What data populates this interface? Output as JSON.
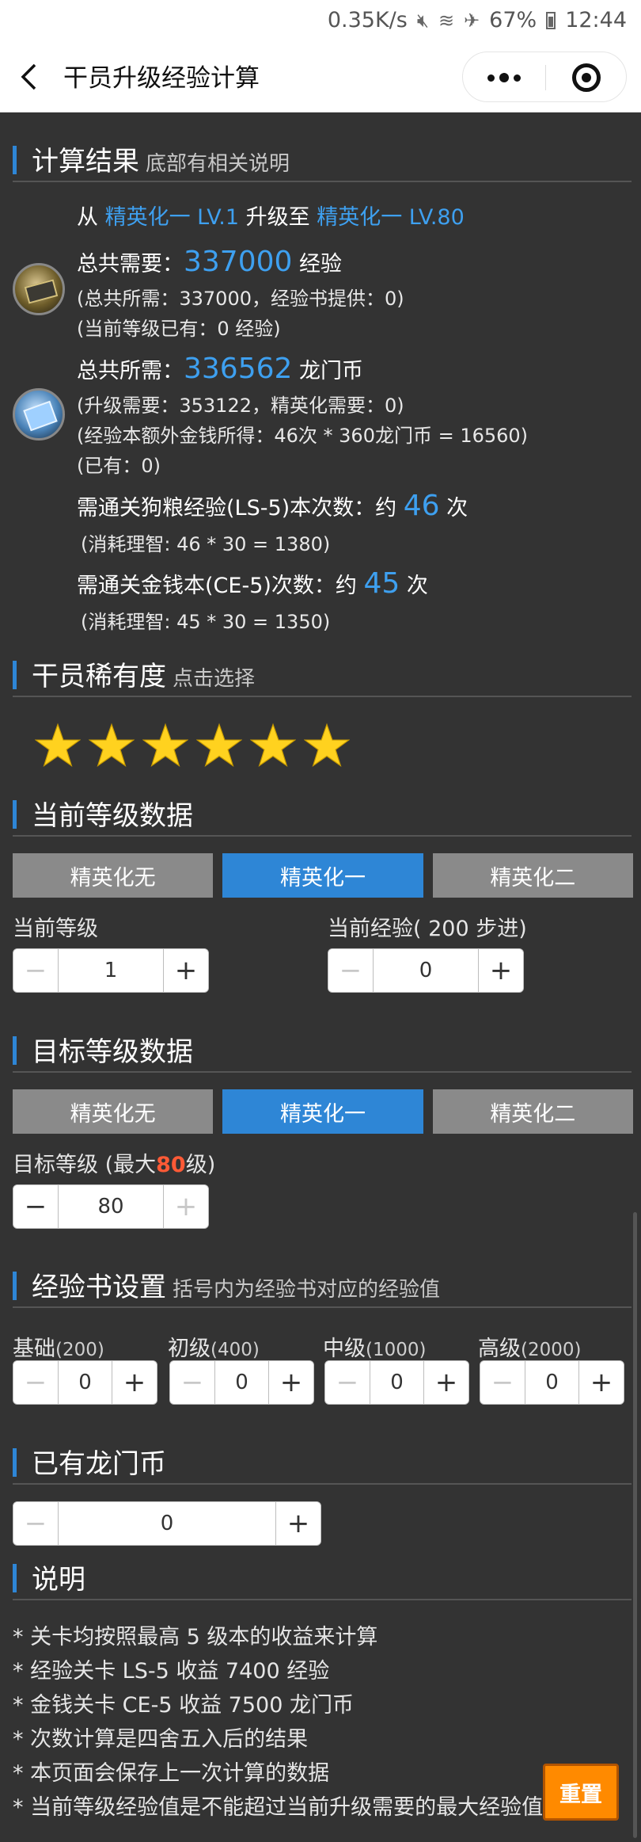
{
  "status_bar": {
    "speed": "0.35K/s",
    "battery": "67%",
    "time": "12:44"
  },
  "header": {
    "title": "干员升级经验计算"
  },
  "result": {
    "heading": "计算结果",
    "heading_sub": "底部有相关说明",
    "route": {
      "from_word": "从",
      "from": "精英化一 LV.1",
      "to_word": "升级至",
      "to": "精英化一 LV.80"
    },
    "exp": {
      "label": "总共需要：",
      "value": "337000",
      "unit": "经验",
      "detail1": "(总共所需：337000，经验书提供：0)",
      "detail2": "(当前等级已有：0 经验)"
    },
    "coin": {
      "label": "总共所需：",
      "value": "336562",
      "unit": "龙门币",
      "detail1": "(升级需要：353122，精英化需要：0)",
      "detail2": "(经验本额外金钱所得：46次 * 360龙门币 = 16560)",
      "detail3": "(已有：0)"
    },
    "ls": {
      "label": "需通关狗粮经验(LS-5)本次数：约",
      "value": "46",
      "unit": "次",
      "detail": "(消耗理智: 46 * 30 = 1380)"
    },
    "ce": {
      "label": "需通关金钱本(CE-5)次数：约",
      "value": "45",
      "unit": "次",
      "detail": "(消耗理智: 45 * 30 = 1350)"
    }
  },
  "rarity": {
    "heading": "干员稀有度",
    "heading_sub": "点击选择",
    "stars": 6,
    "max_stars": 6
  },
  "current": {
    "heading": "当前等级数据",
    "tabs": [
      "精英化无",
      "精英化一",
      "精英化二"
    ],
    "active_tab": 1,
    "level_label": "当前等级",
    "level_value": "1",
    "exp_label": "当前经验( 200 步进)",
    "exp_value": "0"
  },
  "target": {
    "heading": "目标等级数据",
    "tabs": [
      "精英化无",
      "精英化一",
      "精英化二"
    ],
    "active_tab": 1,
    "level_label_pre": "目标等级 (最大",
    "level_max": "80",
    "level_label_post": "级)",
    "level_value": "80"
  },
  "books": {
    "heading": "经验书设置",
    "heading_sub": "括号内为经验书对应的经验值",
    "items": [
      {
        "name": "基础",
        "exp": "(200)",
        "value": "0"
      },
      {
        "name": "初级",
        "exp": "(400)",
        "value": "0"
      },
      {
        "name": "中级",
        "exp": "(1000)",
        "value": "0"
      },
      {
        "name": "高级",
        "exp": "(2000)",
        "value": "0"
      }
    ]
  },
  "coins": {
    "heading": "已有龙门币",
    "value": "0"
  },
  "notes": {
    "heading": "说明",
    "items": [
      "* 关卡均按照最高 5 级本的收益来计算",
      "* 经验关卡 LS-5 收益 7400 经验",
      "* 金钱关卡 CE-5 收益 7500 龙门币",
      "* 次数计算是四舍五入后的结果",
      "* 本页面会保存上一次计算的数据",
      "* 当前等级经验值是不能超过当前升级需要的最大经验值"
    ]
  },
  "reset_label": "重置",
  "colors": {
    "accent": "#2e86d6",
    "highlight": "#3ea0f0",
    "background": "#333333",
    "warning": "#ff5a36",
    "reset": "#ff8a00",
    "star": "#ffd21f"
  }
}
